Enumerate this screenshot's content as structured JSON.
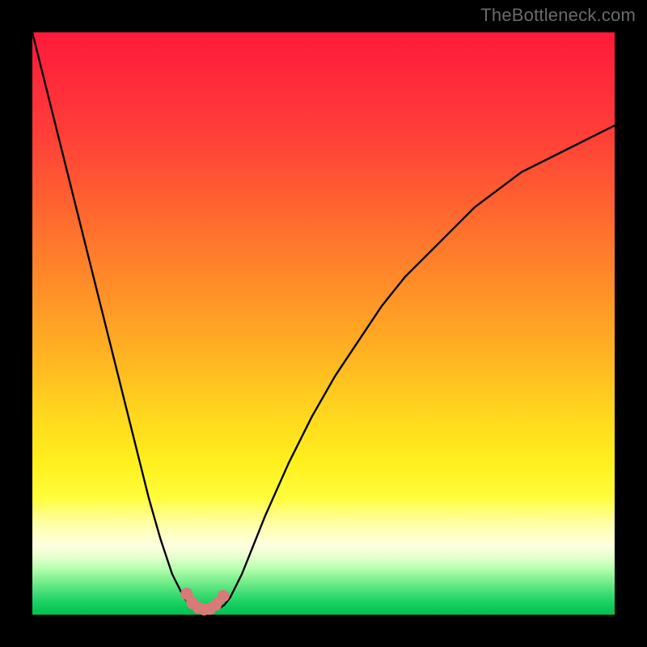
{
  "watermark": "TheBottleneck.com",
  "chart_data": {
    "type": "line",
    "title": "",
    "xlabel": "",
    "ylabel": "",
    "xlim": [
      0,
      100
    ],
    "ylim": [
      0,
      100
    ],
    "grid": false,
    "legend": false,
    "series": [
      {
        "name": "bottleneck-curve",
        "color": "#000000",
        "x": [
          0,
          2,
          4,
          6,
          8,
          10,
          12,
          14,
          16,
          18,
          20,
          22,
          24,
          26,
          27,
          28,
          29,
          30,
          31,
          32,
          33,
          34,
          36,
          38,
          40,
          44,
          48,
          52,
          56,
          60,
          64,
          68,
          72,
          76,
          80,
          84,
          88,
          92,
          96,
          100
        ],
        "y": [
          100,
          92,
          84,
          76,
          68,
          60,
          52,
          44,
          36,
          28,
          20,
          13,
          7,
          3,
          1.7,
          1.0,
          0.6,
          0.5,
          0.6,
          1.0,
          1.7,
          3,
          7,
          12,
          17,
          26,
          34,
          41,
          47,
          53,
          58,
          62,
          66,
          70,
          73,
          76,
          78,
          80,
          82,
          84
        ]
      },
      {
        "name": "bottom-highlight",
        "color": "#d87a78",
        "x": [
          26.5,
          27.5,
          28.5,
          29.5,
          30.5,
          31.5,
          32.8
        ],
        "y": [
          3.6,
          2.0,
          1.2,
          0.9,
          1.0,
          1.7,
          3.2
        ]
      }
    ],
    "background_gradient": {
      "top": "#ff1a3a",
      "middle": "#ffd81e",
      "bottom": "#00c050"
    }
  }
}
